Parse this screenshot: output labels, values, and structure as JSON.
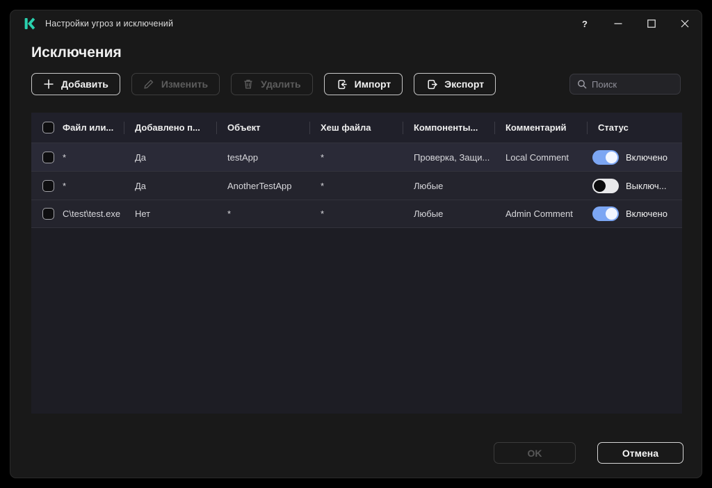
{
  "window": {
    "title": "Настройки угроз и исключений",
    "controls": {
      "help": "?"
    }
  },
  "page": {
    "heading": "Исключения"
  },
  "toolbar": {
    "add_label": "Добавить",
    "edit_label": "Изменить",
    "delete_label": "Удалить",
    "import_label": "Импорт",
    "export_label": "Экспорт",
    "search_placeholder": "Поиск"
  },
  "table": {
    "columns": [
      "Файл или...",
      "Добавлено п...",
      "Объект",
      "Хеш файла",
      "Компоненты...",
      "Комментарий",
      "Статус"
    ],
    "rows": [
      {
        "file": "*",
        "added_by": "Да",
        "object": "testApp",
        "hash": "*",
        "components": "Проверка, Защи...",
        "comment": "Local Comment",
        "status": "Включено",
        "enabled": true
      },
      {
        "file": "*",
        "added_by": "Да",
        "object": "AnotherTestApp",
        "hash": "*",
        "components": "Любые",
        "comment": "",
        "status": "Выключ...",
        "enabled": false
      },
      {
        "file": "C\\test\\test.exe",
        "added_by": "Нет",
        "object": "*",
        "hash": "*",
        "components": "Любые",
        "comment": "Admin Comment",
        "status": "Включено",
        "enabled": true
      }
    ]
  },
  "footer": {
    "ok_label": "OK",
    "cancel_label": "Отмена"
  },
  "colors": {
    "brand_teal": "#2ad0ae",
    "toggle_on": "#7ca6f3",
    "toggle_off": "#e9e9eb",
    "window_bg": "#191919",
    "table_bg": "#1d1d24"
  }
}
